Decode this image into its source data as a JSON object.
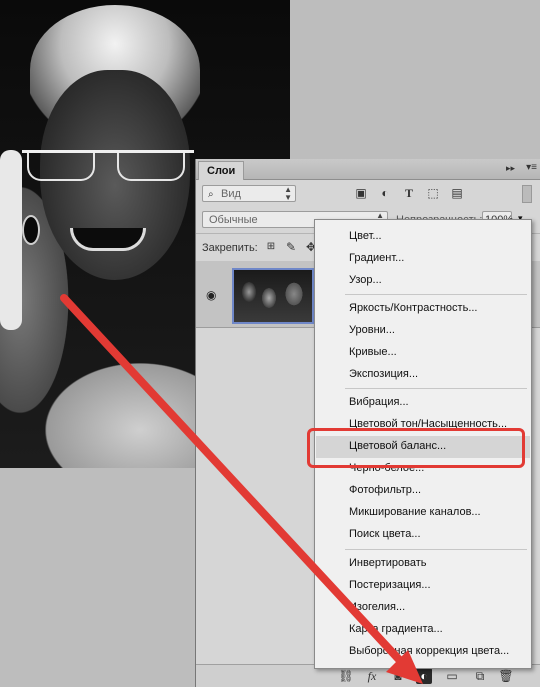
{
  "panel": {
    "tab_label": "Слои",
    "collapse_glyph": "▸▸",
    "filter_placeholder": "Вид",
    "blend_mode": "Обычные",
    "opacity_label": "Непрозрачность:",
    "opacity_value": "100%",
    "lock_label": "Закрепить:"
  },
  "menu": {
    "groups": [
      [
        "Цвет...",
        "Градиент...",
        "Узор..."
      ],
      [
        "Яркость/Контрастность...",
        "Уровни...",
        "Кривые...",
        "Экспозиция..."
      ],
      [
        "Вибрация...",
        "Цветовой тон/Насыщенность...",
        "Цветовой баланс...",
        "Черно-белое...",
        "Фотофильтр...",
        "Микширование каналов...",
        "Поиск цвета..."
      ],
      [
        "Инвертировать",
        "Постеризация...",
        "Изогелия...",
        "Карта градиента...",
        "Выборочная коррекция цвета..."
      ]
    ],
    "highlighted_item": "Цветовой баланс..."
  },
  "colors": {
    "annotation_red": "#e23a34",
    "menu_highlight": "#d5d5d5",
    "thumb_border": "#6f87c8"
  }
}
